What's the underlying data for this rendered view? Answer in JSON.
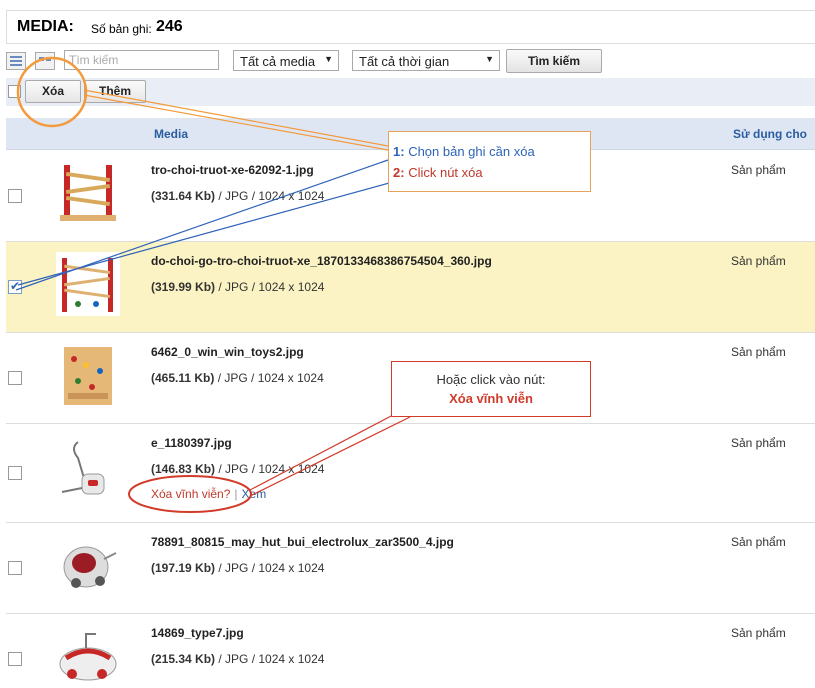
{
  "header": {
    "title": "MEDIA:",
    "count_label": "Số bản ghi:",
    "count": "246"
  },
  "toolbar": {
    "search_placeholder": "Tìm kiếm",
    "media_filter": "Tất cả media",
    "time_filter": "Tất cả thời gian",
    "search_button": "Tìm kiếm"
  },
  "actions": {
    "delete": "Xóa",
    "add": "Thêm"
  },
  "table": {
    "col_media": "Media",
    "col_use": "Sử dụng cho"
  },
  "rows": [
    {
      "name": "tro-choi-truot-xe-62092-1.jpg",
      "size": "(331.64 Kb)",
      "info": " / JPG / 1024 x 1024",
      "use": "Sản phẩm",
      "checked": false
    },
    {
      "name": "do-choi-go-tro-choi-truot-xe_1870133468386754504_360.jpg",
      "size": "(319.99 Kb)",
      "info": " / JPG / 1024 x 1024",
      "use": "Sản phẩm",
      "checked": true
    },
    {
      "name": "6462_0_win_win_toys2.jpg",
      "size": "(465.11 Kb)",
      "info": " / JPG / 1024 x 1024",
      "use": "Sản phẩm",
      "checked": false
    },
    {
      "name": "e_1180397.jpg",
      "size": "(146.83 Kb)",
      "info": " / JPG / 1024 x 1024",
      "use": "Sản phẩm",
      "checked": false,
      "delete_link": "Xóa vĩnh viễn?",
      "sep": "|",
      "view_link": "Xem"
    },
    {
      "name": "78891_80815_may_hut_bui_electrolux_zar3500_4.jpg",
      "size": "(197.19 Kb)",
      "info": " / JPG / 1024 x 1024",
      "use": "Sản phẩm",
      "checked": false
    },
    {
      "name": "14869_type7.jpg",
      "size": "(215.34 Kb)",
      "info": " / JPG / 1024 x 1024",
      "use": "Sản phẩm",
      "checked": false
    }
  ],
  "annotations": {
    "step1_num": "1:",
    "step1_text": "Chọn bản ghi cần xóa",
    "step2_num": "2:",
    "step2_text": "Click nút xóa",
    "alt_text": "Hoặc click vào nút:",
    "alt_bold": "Xóa vĩnh viễn"
  },
  "colors": {
    "accent": "#2a5d9f",
    "selected_row": "#fbf3c3",
    "header_bg": "#dfe6f3",
    "annotation_orange": "#f39a3b",
    "annotation_red": "#d23a2a"
  }
}
